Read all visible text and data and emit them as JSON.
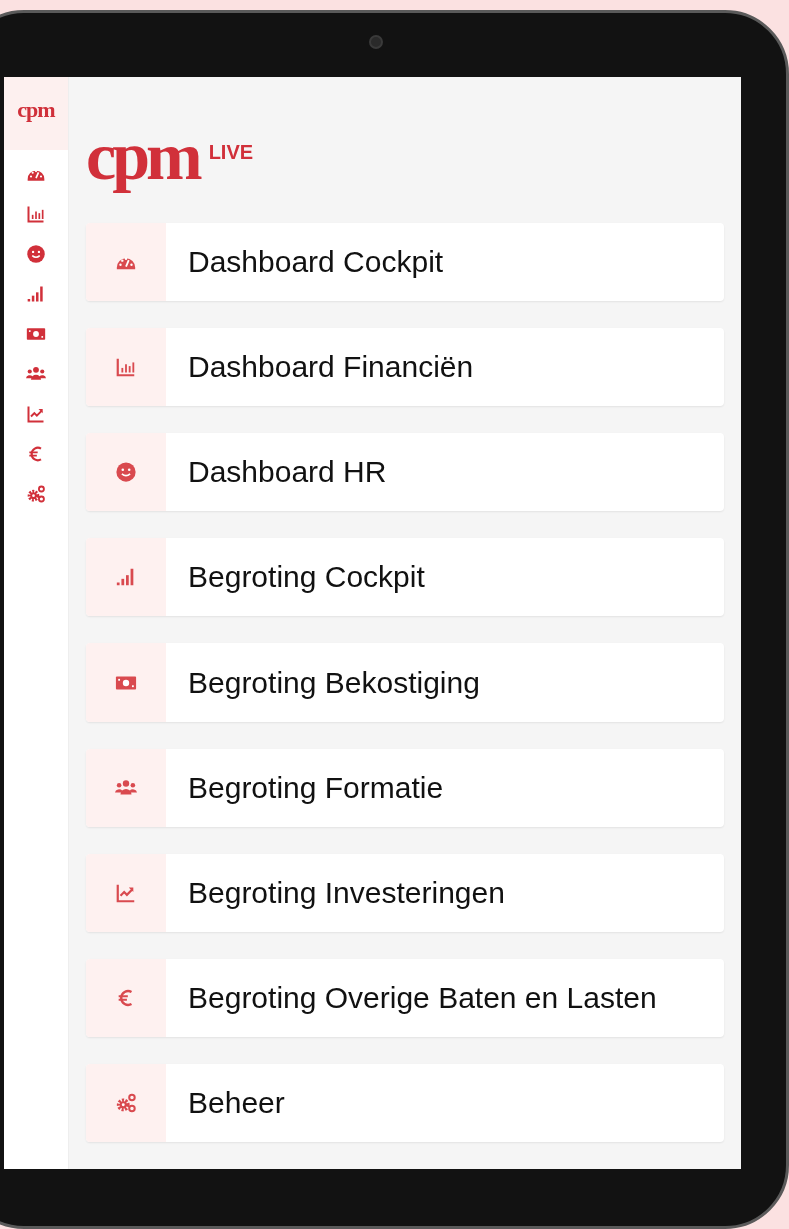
{
  "sidebar": {
    "logo": "cpm",
    "items": [
      {
        "kind": "gauge"
      },
      {
        "kind": "chart-bar"
      },
      {
        "kind": "smile"
      },
      {
        "kind": "signal"
      },
      {
        "kind": "money"
      },
      {
        "kind": "users"
      },
      {
        "kind": "chart-line"
      },
      {
        "kind": "euro"
      },
      {
        "kind": "cogs"
      }
    ]
  },
  "logo": {
    "brand": "cpm",
    "tag": "LIVE"
  },
  "menu": [
    {
      "label": "Dashboard Cockpit",
      "kind": "gauge"
    },
    {
      "label": "Dashboard Financiën",
      "kind": "chart-bar"
    },
    {
      "label": "Dashboard HR",
      "kind": "smile"
    },
    {
      "label": "Begroting Cockpit",
      "kind": "signal"
    },
    {
      "label": "Begroting Bekostiging",
      "kind": "money"
    },
    {
      "label": "Begroting Formatie",
      "kind": "users"
    },
    {
      "label": "Begroting Investeringen",
      "kind": "chart-line"
    },
    {
      "label": "Begroting Overige Baten en Lasten",
      "kind": "euro"
    },
    {
      "label": "Beheer",
      "kind": "cogs"
    }
  ]
}
